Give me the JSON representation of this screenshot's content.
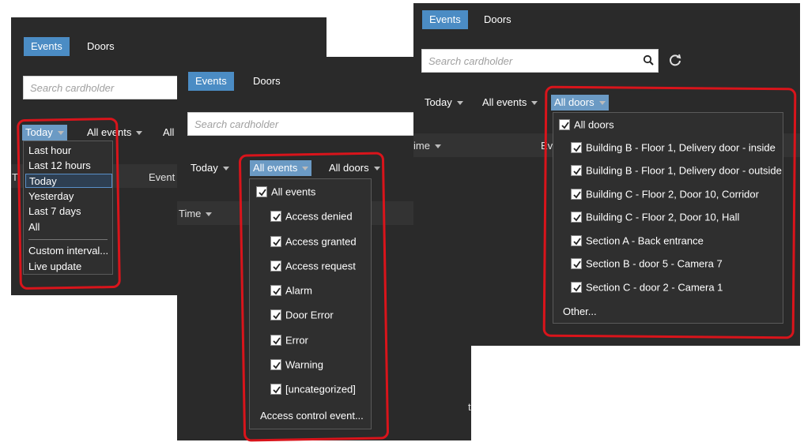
{
  "tabs": {
    "events": "Events",
    "doors": "Doors"
  },
  "search": {
    "placeholder": "Search cardholder"
  },
  "filters": {
    "today": "Today",
    "all_events": "All events",
    "all_doors": "All doors",
    "all_doors_truncated": "All d"
  },
  "columns": {
    "time": "Time",
    "time_truncated_1": "Ti",
    "time_truncated_2": "ime",
    "event": "Event",
    "event_truncated": "Ev"
  },
  "time_menu": {
    "items": [
      "Last hour",
      "Last 12 hours",
      "Today",
      "Yesterday",
      "Last 7 days",
      "All"
    ],
    "selected": "Today",
    "extra": [
      "Custom interval...",
      "Live update"
    ]
  },
  "events_menu": {
    "all": "All events",
    "items": [
      "Access denied",
      "Access granted",
      "Access request",
      "Alarm",
      "Door Error",
      "Error",
      "Warning",
      "[uncategorized]"
    ],
    "footer": "Access control event..."
  },
  "doors_menu": {
    "all": "All doors",
    "items": [
      "Building B - Floor 1, Delivery door - inside",
      "Building B - Floor 1, Delivery door - outside",
      "Building C - Floor 2, Door 10, Corridor",
      "Building C - Floor 2, Door 10, Hall",
      "Section A - Back entrance",
      "Section B - door 5 - Camera 7",
      "Section C - door 2 - Camera 1"
    ],
    "footer": "Other..."
  },
  "misc": {
    "stray_char": "t"
  },
  "colors": {
    "accent": "#4b8cc4",
    "annotation": "#d9141b",
    "panel": "#2a2a2a"
  }
}
